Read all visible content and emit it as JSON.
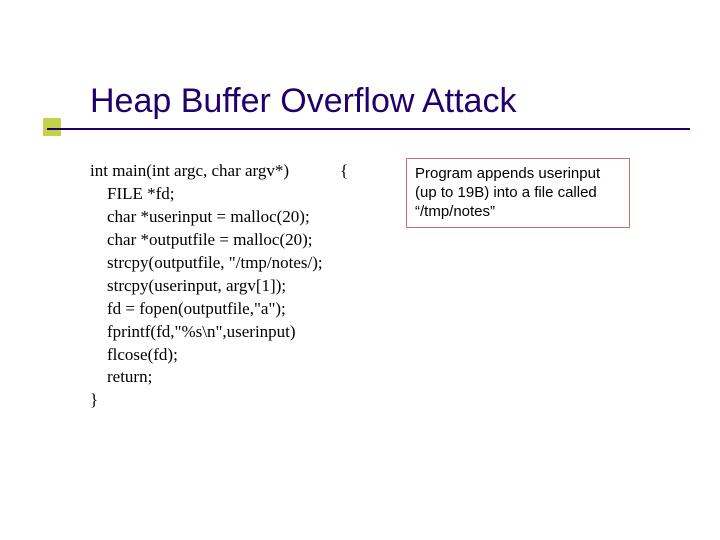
{
  "title": "Heap Buffer Overflow Attack",
  "code": {
    "l0": "int main(int argc, char argv*)            {",
    "l1": "    FILE *fd;",
    "l2": "    char *userinput = malloc(20);",
    "l3": "    char *outputfile = malloc(20);",
    "l4": "    strcpy(outputfile, \"/tmp/notes/);",
    "l5": "    strcpy(userinput, argv[1]);",
    "l6": "    fd = fopen(outputfile,\"a\");",
    "l7": "    fprintf(fd,\"%s\\n\",userinput)",
    "l8": "    flcose(fd);",
    "l9": "    return;",
    "l10": "}"
  },
  "annotation": "Program appends userinput (up to 19B) into a file called “/tmp/notes”"
}
